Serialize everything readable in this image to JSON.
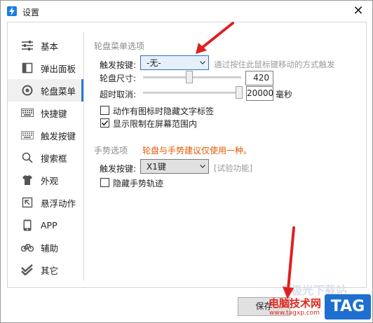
{
  "window": {
    "title": "设置",
    "close_glyph": "✕"
  },
  "sidebar": {
    "items": [
      {
        "label": "基本",
        "icon": "sliders-icon"
      },
      {
        "label": "弹出面板",
        "icon": "popup-panel-icon"
      },
      {
        "label": "轮盘菜单",
        "icon": "wheel-icon",
        "active": true
      },
      {
        "label": "快捷键",
        "icon": "keyboard-icon"
      },
      {
        "label": "触发按键",
        "icon": "keyboard-icon"
      },
      {
        "label": "搜索框",
        "icon": "search-icon"
      },
      {
        "label": "外观",
        "icon": "shirt-icon"
      },
      {
        "label": "悬浮动作",
        "icon": "float-icon"
      },
      {
        "label": "APP",
        "icon": "phone-icon"
      },
      {
        "label": "辅助",
        "icon": "bike-icon"
      },
      {
        "label": "其它",
        "icon": "double-check-icon"
      }
    ]
  },
  "wheel_section": {
    "title": "轮盘菜单选项",
    "trigger_label": "触发按键:",
    "trigger_value": "-无-",
    "trigger_hint": "通过按住此鼠标键移动的方式触发",
    "size_label": "轮盘尺寸:",
    "size_value": "420",
    "size_fraction": 0.47,
    "timeout_label": "超时取消:",
    "timeout_value": "20000",
    "timeout_unit": "毫秒",
    "timeout_fraction": 1.0,
    "hide_text_label": "动作有图标时隐藏文字标签",
    "hide_text_checked": false,
    "limit_screen_label": "显示限制在屏幕范围内",
    "limit_screen_checked": true
  },
  "gesture_section": {
    "title": "手势选项",
    "note": "轮盘与手势建议仅使用一种。",
    "trigger_label": "触发按键:",
    "trigger_value": "X1键",
    "trigger_hint": "[试验功能]",
    "hide_trail_label": "隐藏手势轨迹",
    "hide_trail_checked": false
  },
  "footer": {
    "save_label": "保存"
  },
  "watermark": {
    "text1": "电脑技术网",
    "text2": "www.tagxp.com",
    "badge": "TAG",
    "faded": "极光下载站"
  },
  "colors": {
    "accent": "#2a7ad5",
    "note_red": "#e05a00",
    "annotation_red": "#e02020",
    "badge_blue": "#1f6fd0"
  }
}
